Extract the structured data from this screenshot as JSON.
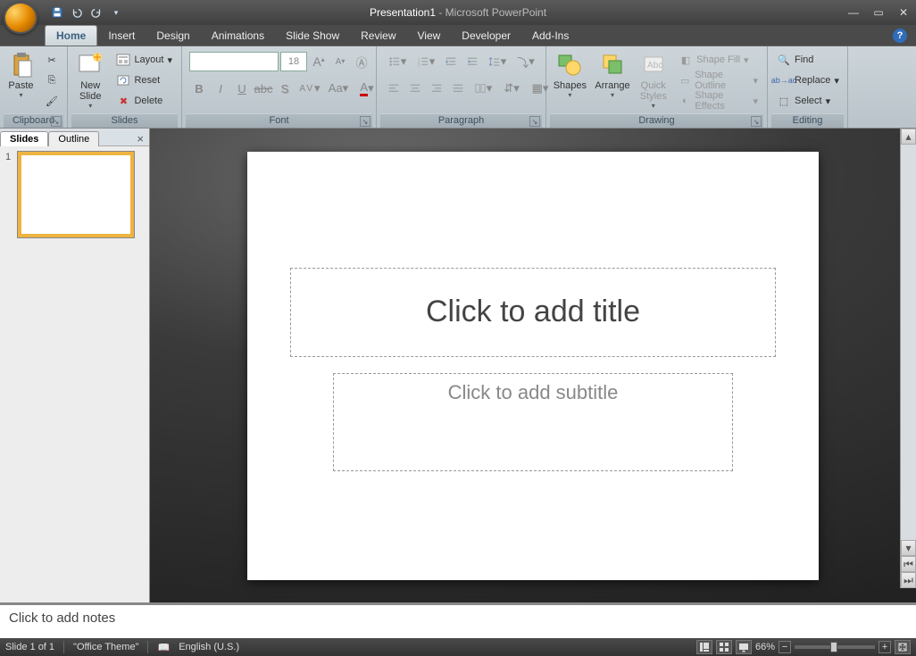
{
  "title": {
    "document": "Presentation1",
    "separator": " - ",
    "app": "Microsoft PowerPoint"
  },
  "tabs": {
    "home": "Home",
    "insert": "Insert",
    "design": "Design",
    "animations": "Animations",
    "slideshow": "Slide Show",
    "review": "Review",
    "view": "View",
    "developer": "Developer",
    "addins": "Add-Ins"
  },
  "ribbon": {
    "clipboard": {
      "title": "Clipboard",
      "paste": "Paste"
    },
    "slides": {
      "title": "Slides",
      "newslide": "New\nSlide",
      "layout": "Layout",
      "reset": "Reset",
      "delete": "Delete"
    },
    "font": {
      "title": "Font",
      "size": "18"
    },
    "paragraph": {
      "title": "Paragraph"
    },
    "drawing": {
      "title": "Drawing",
      "shapes": "Shapes",
      "arrange": "Arrange",
      "quickstyles": "Quick\nStyles",
      "shapefill": "Shape Fill",
      "shapeoutline": "Shape Outline",
      "shapeeffects": "Shape Effects"
    },
    "editing": {
      "title": "Editing",
      "find": "Find",
      "replace": "Replace",
      "select": "Select"
    }
  },
  "panel": {
    "slides": "Slides",
    "outline": "Outline",
    "slide_num": "1"
  },
  "slide": {
    "title_placeholder": "Click to add title",
    "subtitle_placeholder": "Click to add subtitle"
  },
  "notes": {
    "placeholder": "Click to add notes"
  },
  "status": {
    "slide": "Slide 1 of 1",
    "theme": "\"Office Theme\"",
    "lang": "English (U.S.)",
    "zoom": "66%"
  }
}
